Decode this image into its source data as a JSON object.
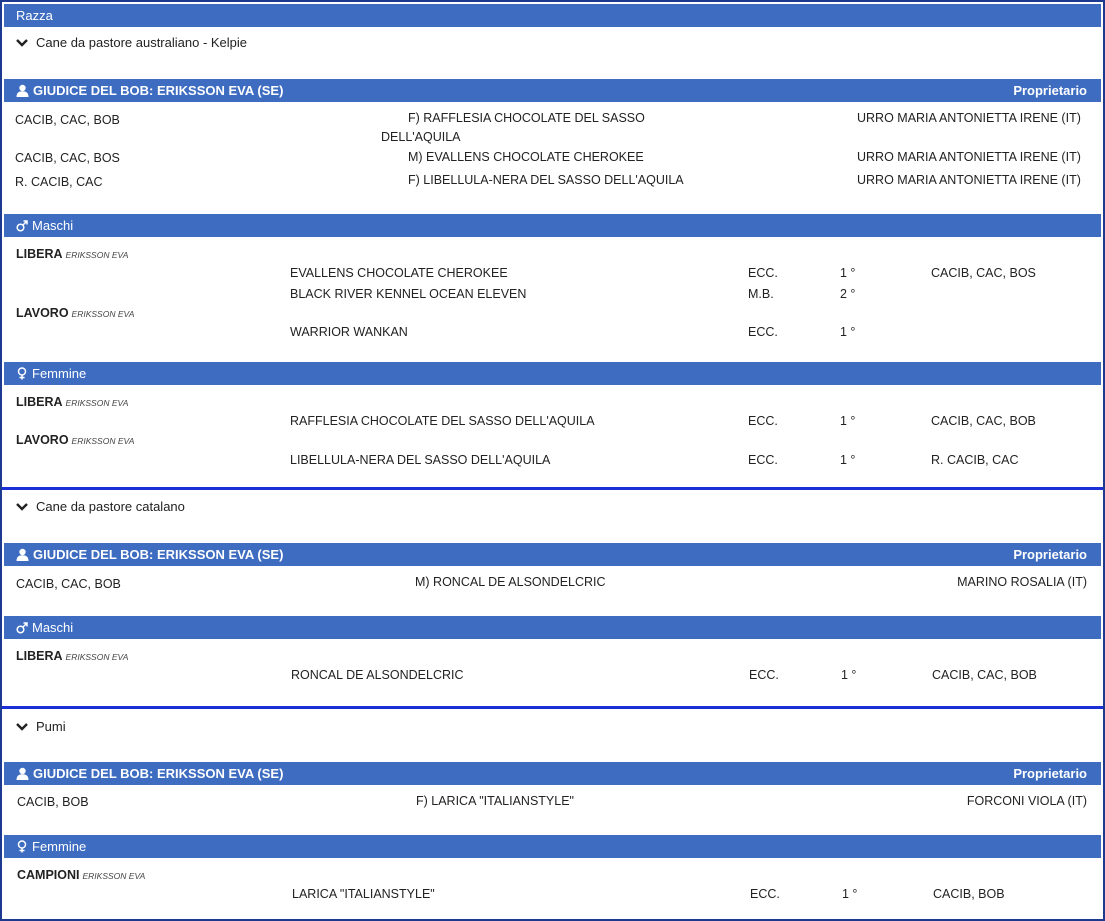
{
  "header": {
    "title": "Razza"
  },
  "breeds": [
    {
      "name": "Cane da pastore australiano - Kelpie",
      "judge_bar": {
        "title": "GIUDICE DEL BOB: ERIKSSON EVA (SE)",
        "owner_label": "Proprietario"
      },
      "awards": [
        {
          "title": "CACIB, CAC, BOB",
          "dog_line1": "F) RAFFLESIA CHOCOLATE DEL SASSO",
          "dog_line2": "DELL'AQUILA",
          "owner": "URRO MARIA ANTONIETTA IRENE (IT)"
        },
        {
          "title": "CACIB, CAC, BOS",
          "dog_line1": "M) EVALLENS CHOCOLATE CHEROKEE",
          "owner": "URRO MARIA ANTONIETTA IRENE (IT)"
        },
        {
          "title": "R. CACIB, CAC",
          "dog_line1": "F) LIBELLULA-NERA DEL SASSO DELL'AQUILA",
          "owner": "URRO MARIA ANTONIETTA IRENE (IT)"
        }
      ],
      "sections": [
        {
          "label": "Maschi",
          "classes": [
            {
              "name": "LIBERA",
              "judge": "ERIKSSON EVA",
              "entries": [
                {
                  "dog": "EVALLENS CHOCOLATE CHEROKEE",
                  "grade": "ECC.",
                  "place": "1 °",
                  "titles": "CACIB, CAC, BOS"
                },
                {
                  "dog": "BLACK RIVER KENNEL OCEAN ELEVEN",
                  "grade": "M.B.",
                  "place": "2 °",
                  "titles": ""
                }
              ]
            },
            {
              "name": "LAVORO",
              "judge": "ERIKSSON EVA",
              "entries": [
                {
                  "dog": "WARRIOR WANKAN",
                  "grade": "ECC.",
                  "place": "1 °",
                  "titles": ""
                }
              ]
            }
          ]
        },
        {
          "label": "Femmine",
          "classes": [
            {
              "name": "LIBERA",
              "judge": "ERIKSSON EVA",
              "entries": [
                {
                  "dog": "RAFFLESIA CHOCOLATE DEL SASSO DELL'AQUILA",
                  "grade": "ECC.",
                  "place": "1 °",
                  "titles": "CACIB, CAC, BOB"
                }
              ]
            },
            {
              "name": "LAVORO",
              "judge": "ERIKSSON EVA",
              "entries": [
                {
                  "dog": "LIBELLULA-NERA DEL SASSO DELL'AQUILA",
                  "grade": "ECC.",
                  "place": "1 °",
                  "titles": "R. CACIB, CAC"
                }
              ]
            }
          ]
        }
      ]
    },
    {
      "name": "Cane da pastore catalano",
      "judge_bar": {
        "title": "GIUDICE DEL BOB: ERIKSSON EVA (SE)",
        "owner_label": "Proprietario"
      },
      "awards": [
        {
          "title": "CACIB, CAC, BOB",
          "dog_line1": "M) RONCAL DE ALSONDELCRIC",
          "owner": "MARINO ROSALIA (IT)"
        }
      ],
      "sections": [
        {
          "label": "Maschi",
          "classes": [
            {
              "name": "LIBERA",
              "judge": "ERIKSSON EVA",
              "entries": [
                {
                  "dog": "RONCAL DE ALSONDELCRIC",
                  "grade": "ECC.",
                  "place": "1 °",
                  "titles": "CACIB, CAC, BOB"
                }
              ]
            }
          ]
        }
      ]
    },
    {
      "name": "Pumi",
      "judge_bar": {
        "title": "GIUDICE DEL BOB: ERIKSSON EVA (SE)",
        "owner_label": "Proprietario"
      },
      "awards": [
        {
          "title": "CACIB, BOB",
          "dog_line1": "F) LARICA \"ITALIANSTYLE\"",
          "owner": "FORCONI VIOLA (IT)"
        }
      ],
      "sections": [
        {
          "label": "Femmine",
          "classes": [
            {
              "name": "CAMPIONI",
              "judge": "ERIKSSON EVA",
              "entries": [
                {
                  "dog": "LARICA \"ITALIANSTYLE\"",
                  "grade": "ECC.",
                  "place": "1 °",
                  "titles": "CACIB, BOB"
                }
              ]
            }
          ]
        }
      ]
    }
  ],
  "icons": {
    "judge": "user-icon",
    "male": "male-icon",
    "female": "female-icon",
    "expand": "chevron-down-icon"
  },
  "colors": {
    "bar": "#3d6cc1",
    "separator": "#1a2fd6",
    "border": "#1c3a8f"
  }
}
